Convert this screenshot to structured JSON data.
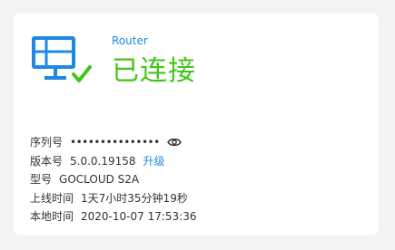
{
  "card": {
    "device_type": "Router",
    "status": "已连接",
    "icons": {
      "router": "router-icon",
      "check": "check-icon",
      "eye": "eye-icon"
    },
    "colors": {
      "link": "#1e88e5",
      "status": "#43c51a"
    }
  },
  "info": {
    "serial_label": "序列号",
    "serial_value": "•••••••••••••••",
    "version_label": "版本号",
    "version_value": "5.0.0.19158",
    "upgrade_label": "升级",
    "model_label": "型号",
    "model_value": "GOCLOUD S2A",
    "uptime_label": "上线时间",
    "uptime_value": "1天7小时35分钟19秒",
    "local_time_label": "本地时间",
    "local_time_value": "2020-10-07 17:53:36"
  }
}
